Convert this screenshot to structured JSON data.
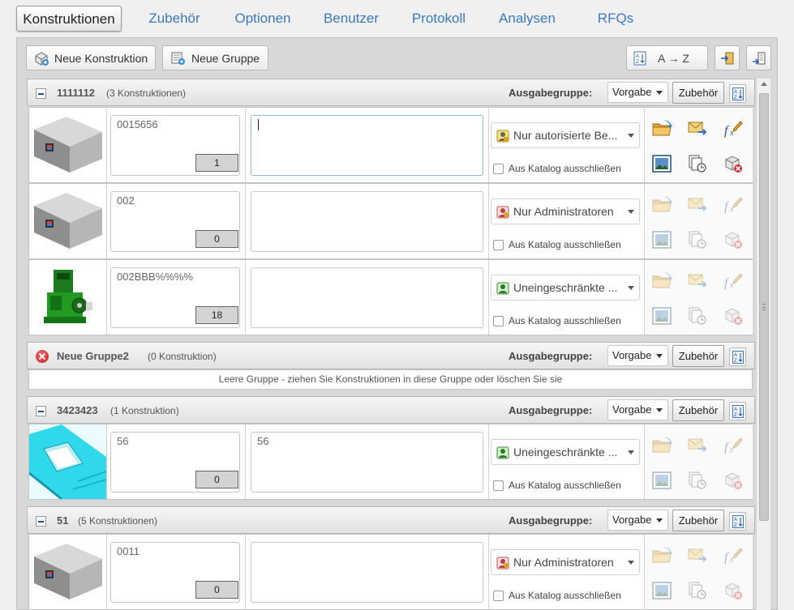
{
  "tabs": [
    {
      "label": "Konstruktionen",
      "active": true
    },
    {
      "label": "Zubehör"
    },
    {
      "label": "Optionen"
    },
    {
      "label": "Benutzer"
    },
    {
      "label": "Protokoll"
    },
    {
      "label": "Analysen"
    },
    {
      "label": "RFQs"
    }
  ],
  "toolbar": {
    "new_construction": "Neue Konstruktion",
    "new_group": "Neue Gruppe",
    "sort": "A → Z"
  },
  "labels": {
    "ausgabegruppe": "Ausgabegruppe:",
    "zubehoer": "Zubehör",
    "exclude": "Aus Katalog ausschließen",
    "empty_group": "Leere Gruppe - ziehen Sie Konstruktionen in diese Gruppe oder löschen Sie sie"
  },
  "groups": [
    {
      "name": "1111112",
      "count": "(3 Konstruktionen)",
      "ausgabe": "Vorgabe",
      "items": [
        {
          "name": "0015656",
          "count": "1",
          "desc": "",
          "perm": "Nur autorisierte Be...",
          "perm_icon": "user-key-icon",
          "thumb": "box"
        },
        {
          "name": "002",
          "count": "0",
          "desc": "",
          "perm": "Nur Administratoren",
          "perm_icon": "admin-user-icon",
          "thumb": "box"
        },
        {
          "name": "002BBB%%%%",
          "count": "18",
          "desc": "",
          "perm": "Uneingeschränkte ...",
          "perm_icon": "public-user-icon",
          "thumb": "machine"
        }
      ]
    },
    {
      "name": "Neue Gruppe2",
      "count": "(0 Konstruktion)",
      "ausgabe": "Vorgabe",
      "items": []
    },
    {
      "name": "3423423",
      "count": "(1 Konstruktion)",
      "ausgabe": "Vorgabe",
      "items": [
        {
          "name": "56",
          "count": "0",
          "desc": "56",
          "perm": "Uneingeschränkte ...",
          "perm_icon": "public-user-icon",
          "thumb": "cyan"
        }
      ]
    },
    {
      "name": "51",
      "count": "(5 Konstruktionen)",
      "ausgabe": "Vorgabe",
      "items": [
        {
          "name": "0011",
          "count": "0",
          "desc": "",
          "perm": "Nur Administratoren",
          "perm_icon": "admin-user-icon",
          "thumb": "box"
        }
      ]
    }
  ],
  "colors": {
    "accent": "#3b78c4",
    "panel": "#d8d8d8",
    "delete": "#d32020"
  }
}
